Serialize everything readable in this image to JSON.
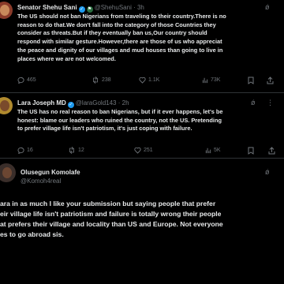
{
  "tweet1": {
    "name": "Senator Shehu Sani",
    "handle": "@ShehuSani · 3h",
    "lines": [
      "The US should not ban Nigerians from traveling to their country.There is no",
      "reason to do that.We don't fall into the category of those Countries they",
      "consider as threats.But if they eventually ban us,Our country should",
      "respond with similar gesture.However,there are those of us who appreciat",
      "the peace and dignity of our villages and mud houses than going to live in",
      "places where we are not welcomed."
    ],
    "replies": "465",
    "reposts": "238",
    "likes": "1.1K",
    "views": "73K"
  },
  "tweet2": {
    "name": "Lara Joseph MD",
    "handle": "@laraGold143 · 2h",
    "lines": [
      "The US has no real reason to ban Nigerians, but if it ever happens, let's be",
      "honest: blame our leaders who ruined the country, not the US. Pretending",
      "to prefer village life isn't patriotism, it's just coping with failure."
    ],
    "replies": "16",
    "reposts": "12",
    "likes": "251",
    "views": "5K"
  },
  "tweet3": {
    "name": "Olusegun Komolafe",
    "handle": "@Komoh4real"
  },
  "reply": {
    "lines": [
      "ara in as much I like your submission but saying people that prefer",
      "eir village life isn't patriotism and failure is totally wrong their people",
      "at prefers their village and locality than US and Europe. Not everyone",
      "es to go abroad sis."
    ]
  },
  "colors": {
    "background": "#000000",
    "text": "#e7e9ea",
    "muted": "#71767b",
    "verified": "#1d9bf0",
    "divider": "#2f3336"
  }
}
